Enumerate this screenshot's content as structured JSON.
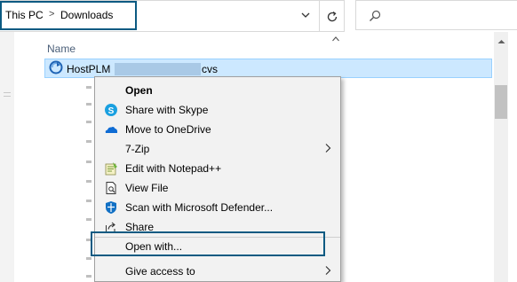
{
  "address": {
    "crumbs": [
      "This PC",
      "Downloads"
    ],
    "separator": ">"
  },
  "file_list": {
    "column_name": "Name",
    "selected_file": {
      "name_start": "HostPLM",
      "name_end": "cvs"
    }
  },
  "context_menu": {
    "items": [
      {
        "label": "Open",
        "icon": "default-open",
        "bold": true
      },
      {
        "label": "Share with Skype",
        "icon": "skype-icon"
      },
      {
        "label": "Move to OneDrive",
        "icon": "onedrive-icon"
      },
      {
        "label": "7-Zip",
        "icon": "",
        "submenu": true
      },
      {
        "label": "Edit with Notepad++",
        "icon": "notepadpp-icon"
      },
      {
        "label": "View File",
        "icon": "view-file-icon"
      },
      {
        "label": "Scan with Microsoft Defender...",
        "icon": "defender-icon"
      },
      {
        "label": "Share",
        "icon": "share-icon"
      },
      {
        "label": "Open with...",
        "icon": ""
      },
      {
        "label": "Give access to",
        "icon": "",
        "submenu": true
      }
    ],
    "chevron": ">"
  },
  "colors": {
    "highlight_border": "#0b5a82",
    "selection_fill": "#cce8ff",
    "menu_bg": "#f2f2f2"
  }
}
